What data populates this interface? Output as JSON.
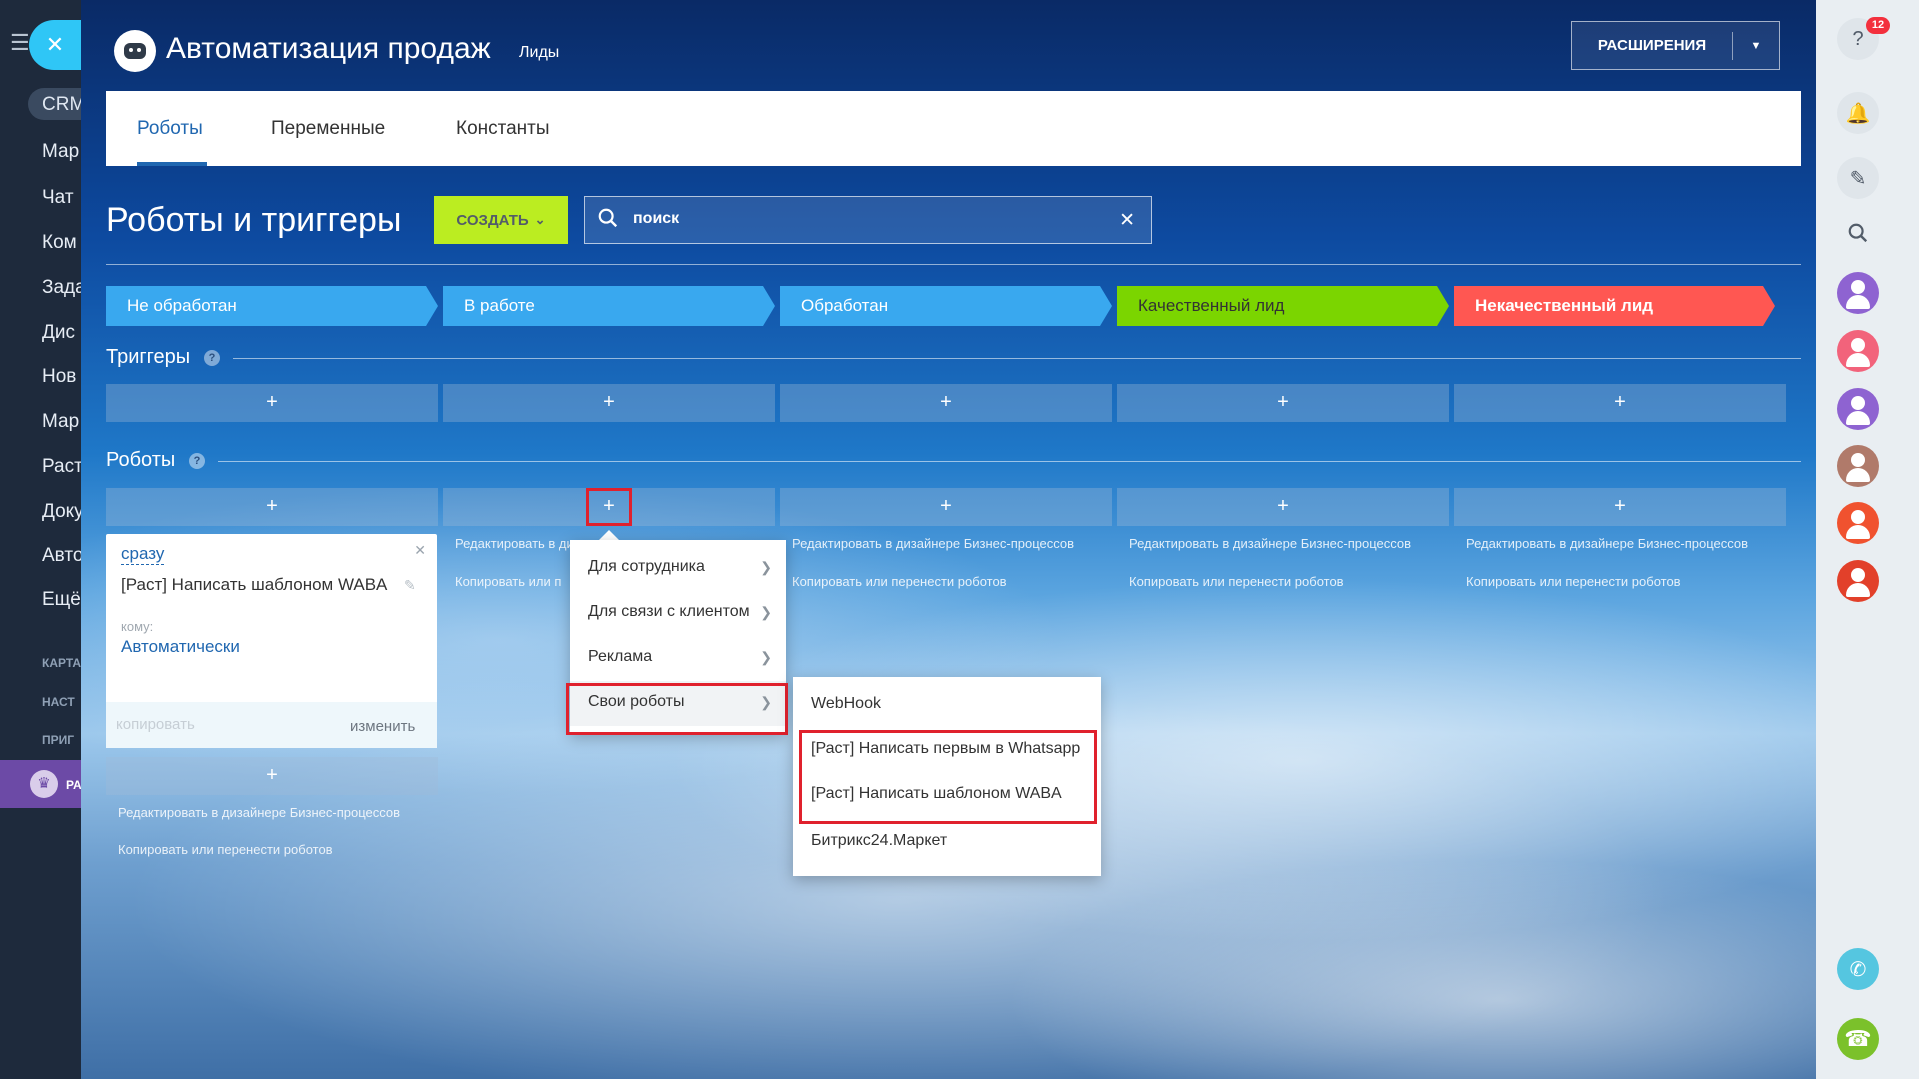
{
  "left_sidebar": {
    "crm": "CRM",
    "items": [
      "Мар",
      "Чат",
      "Ком",
      "Зада",
      "Дис",
      "Нов",
      "Мар",
      "Раст",
      "Доку",
      "Авто",
      "Ещё"
    ],
    "small_items": [
      "КАРТА",
      "НАСТ",
      "ПРИГ"
    ],
    "promo_label": "РА"
  },
  "header": {
    "title": "Автоматизация продаж",
    "subtitle": "Лиды",
    "extensions_label": "РАСШИРЕНИЯ"
  },
  "tabs": [
    {
      "label": "Роботы",
      "active": true
    },
    {
      "label": "Переменные",
      "active": false
    },
    {
      "label": "Константы",
      "active": false
    }
  ],
  "toolbar": {
    "section_title": "Роботы и триггеры",
    "create_label": "СОЗДАТЬ",
    "search_value": "поиск"
  },
  "stages": [
    {
      "label": "Не обработан",
      "color": "#39a8ef"
    },
    {
      "label": "В работе",
      "color": "#39a8ef"
    },
    {
      "label": "Обработан",
      "color": "#39a8ef"
    },
    {
      "label": "Качественный лид",
      "color": "#7bd500"
    },
    {
      "label": "Некачественный лид",
      "color": "#ff5752"
    }
  ],
  "triggers": {
    "title": "Триггеры",
    "add": "+"
  },
  "robots": {
    "title": "Роботы",
    "add": "+"
  },
  "column_links": {
    "edit": "Редактировать в дизайнере Бизнес-процессов",
    "copy": "Копировать или перенести роботов",
    "edit_cut": "Редактировать в ди",
    "copy_cut": "Копировать или п"
  },
  "robot_card": {
    "when": "сразу",
    "name": "[Раст] Написать шаблоном WABA",
    "to_label": "кому:",
    "to_value": "Автоматически",
    "copy_label": "копировать",
    "edit_label": "изменить"
  },
  "menu_primary": [
    "Для сотрудника",
    "Для связи с клиентом",
    "Реклама",
    "Свои роботы"
  ],
  "menu_secondary": [
    "WebHook",
    "[Раст] Написать первым в Whatsapp",
    "[Раст] Написать шаблоном WABA",
    "Битрикс24.Маркет"
  ],
  "right_sidebar": {
    "badge": "12",
    "avatar_colors": [
      "#8e63d1",
      "#f2637b",
      "#8e63d1",
      "#b07a6a",
      "#f0522f",
      "#e2402a"
    ]
  }
}
